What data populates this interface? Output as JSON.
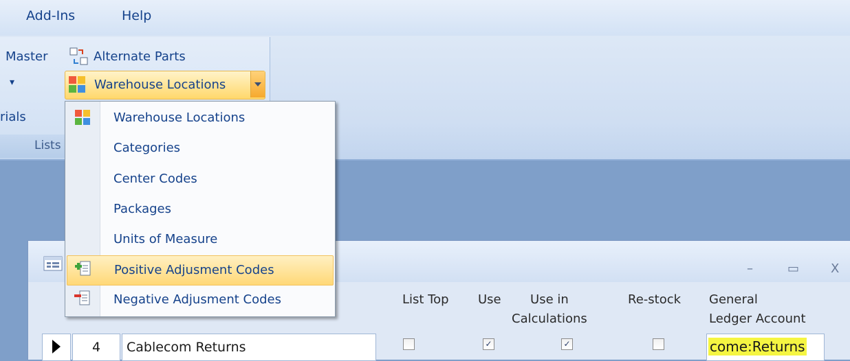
{
  "menubar": {
    "items": [
      {
        "label": "Add-Ins"
      },
      {
        "label": "Help"
      }
    ]
  },
  "ribbon": {
    "master_label": "Master",
    "alternate_parts_label": "Alternate Parts",
    "small_arrow": "▾",
    "materials_label": "rials",
    "group_label": "Lists",
    "warehouse_button_label": "Warehouse Locations"
  },
  "dropdown": {
    "items": [
      {
        "label": "Warehouse Locations",
        "icon": "grid-icon"
      },
      {
        "label": "Categories"
      },
      {
        "label": "Center Codes"
      },
      {
        "label": "Packages"
      },
      {
        "label": "Units of Measure"
      },
      {
        "label": "Positive Adjusment Codes",
        "icon": "plus-document-icon",
        "highlighted": true
      },
      {
        "label": "Negative Adjusment Codes",
        "icon": "minus-document-icon"
      }
    ]
  },
  "window": {
    "minimize": "–",
    "maximize": "▭",
    "close": "X",
    "columns": [
      {
        "label": "List Top"
      },
      {
        "label": "Use"
      },
      {
        "label": "Use in\nCalculations"
      },
      {
        "label": "Re-stock"
      },
      {
        "label": "General\nLedger Account"
      }
    ],
    "row": {
      "id": "4",
      "name": "Cablecom Returns",
      "list_top": false,
      "use": true,
      "use_in_calculations": true,
      "restock": false,
      "gl_account": "come:Returns"
    }
  },
  "colors": {
    "accent": "#15428b",
    "highlight": "#ffd877",
    "gl_highlight": "#f5f542"
  }
}
